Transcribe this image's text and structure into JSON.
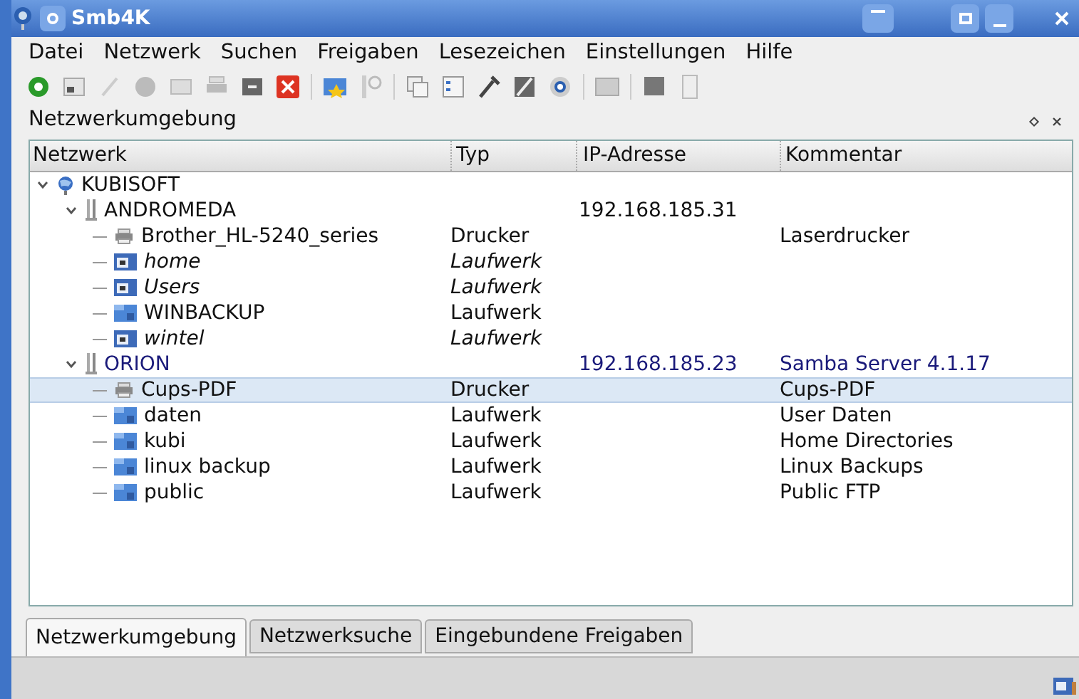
{
  "window": {
    "title": "Smb4K"
  },
  "menu": [
    "Datei",
    "Netzwerk",
    "Suchen",
    "Freigaben",
    "Lesezeichen",
    "Einstellungen",
    "Hilfe"
  ],
  "dock": {
    "title": "Netzwerkumgebung"
  },
  "table": {
    "columns": [
      "Netzwerk",
      "Typ",
      "IP-Adresse",
      "Kommentar"
    ],
    "rows": [
      {
        "kind": "workgroup",
        "name": "KUBISOFT",
        "expanded": true,
        "selected": false,
        "children": [
          {
            "kind": "host",
            "name": "ANDROMEDA",
            "ip": "192.168.185.31",
            "expanded": true,
            "master": false,
            "selected": false,
            "children": [
              {
                "kind": "printer",
                "name": "Brother_HL-5240_series",
                "type": "Drucker",
                "comment": "Laserdrucker",
                "mounted": false,
                "selected": false
              },
              {
                "kind": "share",
                "name": "home",
                "type": "Laufwerk",
                "mounted": true,
                "selected": false
              },
              {
                "kind": "share",
                "name": "Users",
                "type": "Laufwerk",
                "mounted": true,
                "selected": false
              },
              {
                "kind": "share",
                "name": "WINBACKUP",
                "type": "Laufwerk",
                "mounted": false,
                "selected": false
              },
              {
                "kind": "share",
                "name": "wintel",
                "type": "Laufwerk",
                "mounted": true,
                "selected": false
              }
            ]
          },
          {
            "kind": "host",
            "name": "ORION",
            "ip": "192.168.185.23",
            "comment": "Samba Server 4.1.17",
            "expanded": true,
            "master": true,
            "selected": false,
            "children": [
              {
                "kind": "printer",
                "name": "Cups-PDF",
                "type": "Drucker",
                "comment": "Cups-PDF",
                "mounted": false,
                "selected": true
              },
              {
                "kind": "share",
                "name": "daten",
                "type": "Laufwerk",
                "comment": "User Daten",
                "mounted": false,
                "selected": false
              },
              {
                "kind": "share",
                "name": "kubi",
                "type": "Laufwerk",
                "comment": "Home Directories",
                "mounted": false,
                "selected": false
              },
              {
                "kind": "share",
                "name": "linux backup",
                "type": "Laufwerk",
                "comment": "Linux Backups",
                "mounted": false,
                "selected": false
              },
              {
                "kind": "share",
                "name": "public",
                "type": "Laufwerk",
                "comment": "Public FTP",
                "mounted": false,
                "selected": false
              }
            ]
          }
        ]
      }
    ]
  },
  "tabs": [
    {
      "label": "Netzwerkumgebung",
      "selected": true
    },
    {
      "label": "Netzwerksuche",
      "selected": false
    },
    {
      "label": "Eingebundene Freigaben",
      "selected": false
    }
  ]
}
